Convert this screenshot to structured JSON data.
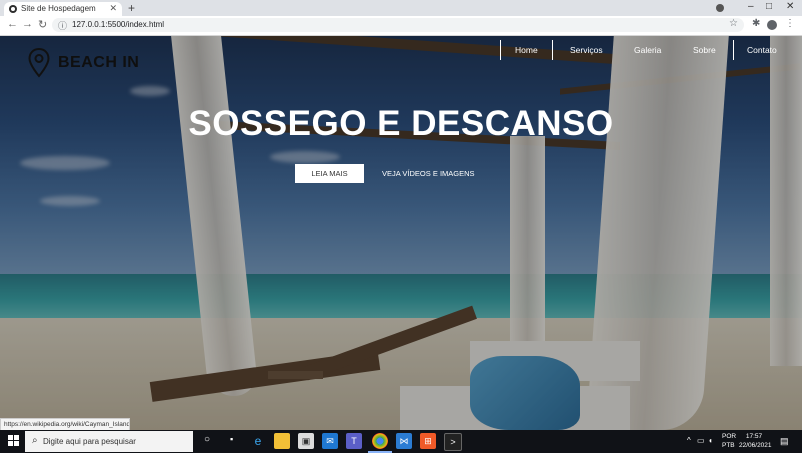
{
  "browser": {
    "tab_title": "Site de Hospedagem",
    "url": "127.0.0.1:5500/index.html",
    "icons": [
      "back-icon",
      "forward-icon",
      "reload-icon",
      "info-icon",
      "bookmark-star-icon",
      "extensions-icon",
      "profile-icon",
      "menu-icon"
    ]
  },
  "site": {
    "logo_text": "BEACH IN",
    "nav": [
      "Home",
      "Serviços",
      "Galeria",
      "Sobre",
      "Contato"
    ],
    "hero_title": "SOSSEGO E DESCANSO",
    "btn_primary": "LEIA MAIS",
    "btn_secondary": "VEJA VÍDEOS E IMAGENS",
    "status_url": "https://en.wikipedia.org/wiki/Cayman_Islands"
  },
  "taskbar": {
    "search_placeholder": "Digite aqui para pesquisar",
    "lang_line1": "POR",
    "lang_line2": "PTB",
    "time": "17:57",
    "date": "22/06/2021"
  },
  "colors": {
    "hero_overlay": "#000000",
    "tab_bg": "#dee1e6",
    "taskbar": "#101217"
  }
}
